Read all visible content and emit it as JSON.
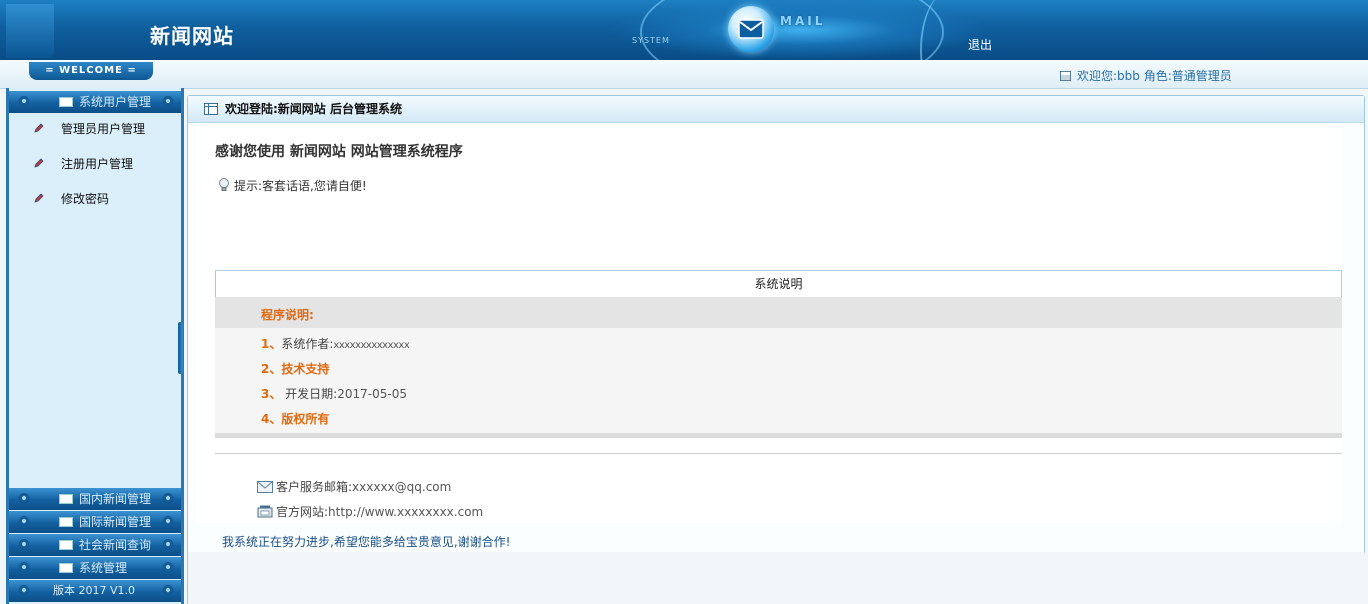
{
  "header": {
    "site_title": "新闻网站",
    "system_label": "SYSTEM",
    "mail_word": "MAIL",
    "logout_label": "退出"
  },
  "welcome": {
    "tab_label": "= WELCOME =",
    "user_info": "欢迎您:bbb 角色:普通管理员"
  },
  "sidebar": {
    "groups": [
      {
        "label": "系统用户管理"
      },
      {
        "label": "国内新闻管理"
      },
      {
        "label": "国际新闻管理"
      },
      {
        "label": "社会新闻查询"
      },
      {
        "label": "系统管理"
      }
    ],
    "sub_items": [
      {
        "label": "管理员用户管理"
      },
      {
        "label": "注册用户管理"
      },
      {
        "label": "修改密码"
      }
    ],
    "version": "版本 2017 V1.0"
  },
  "main": {
    "title": "欢迎登陆:新闻网站 后台管理系统",
    "thanks": "感谢您使用 新闻网站 网站管理系统程序",
    "tip": "提示:客套话语,您请自便!",
    "sysdesc_title": "系统说明",
    "prog_title": "程序说明:",
    "rows": [
      {
        "num": "1、",
        "label": "系统作者:",
        "value": "xxxxxxxxxxxxxx"
      },
      {
        "num": "2、",
        "label": "技术支持"
      },
      {
        "num": "3、",
        "label": " 开发日期:",
        "value": "2017-05-05"
      },
      {
        "num": "4、",
        "label": "版权所有"
      }
    ],
    "contact_email_label": "客户服务邮箱:",
    "contact_email": "xxxxxx@qq.com",
    "contact_site_label": "官方网站:",
    "contact_site": "http://www.xxxxxxxx.com",
    "footer": "我系统正在努力进步,希望您能多给宝贵意见,谢谢合作!"
  },
  "colors": {
    "header_blue": "#0f5f9e",
    "accent_orange": "#e06a10",
    "link_blue": "#2a6fa6"
  }
}
